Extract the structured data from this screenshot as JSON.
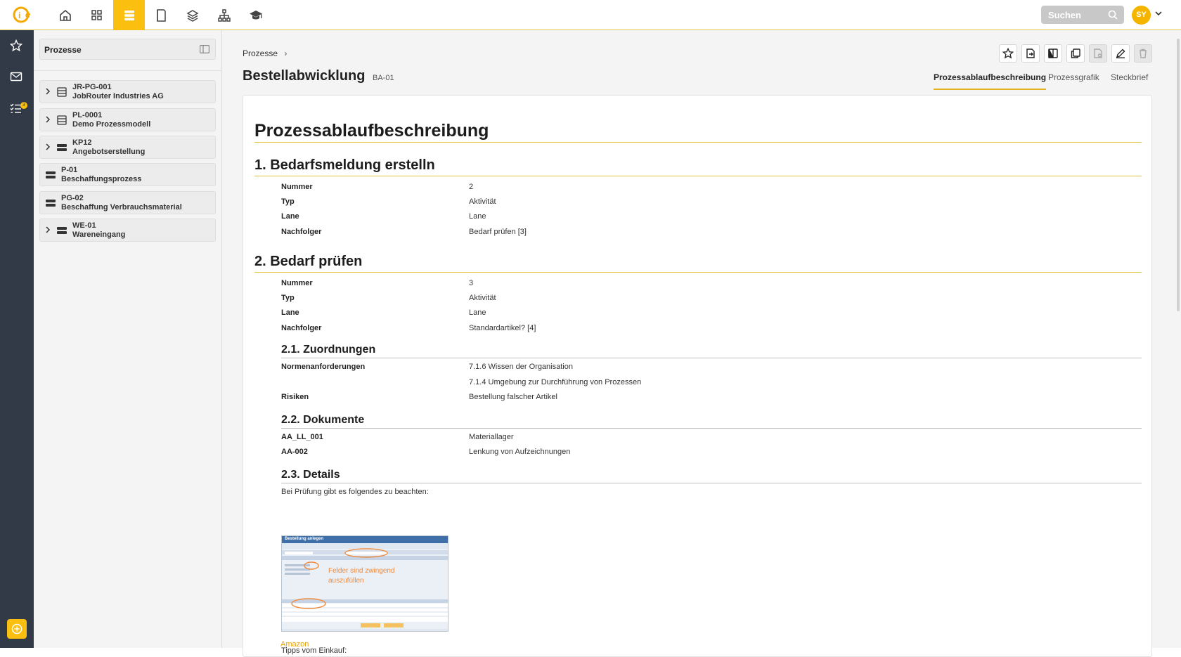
{
  "topbar": {
    "search_label": "Suchen",
    "avatar_initials": "SY",
    "nav_icons": [
      "home-icon",
      "dashboard-icon",
      "processes-icon",
      "documents-icon",
      "layers-icon",
      "org-chart-icon",
      "academy-icon"
    ],
    "active_nav": "processes-icon",
    "accent_color": "#fbbf0f"
  },
  "rail": {
    "icons": [
      "star-icon",
      "mail-icon",
      "task-list-icon"
    ],
    "task_badge": "3",
    "add_icon": "plus-circle-icon"
  },
  "sidebar": {
    "title": "Prozesse",
    "items": [
      {
        "code": "JR-PG-001",
        "name": "JobRouter Industries AG",
        "expandable": true,
        "icon": "process-group-icon"
      },
      {
        "code": "PL-0001",
        "name": "Demo Prozessmodell",
        "expandable": true,
        "icon": "process-group-icon"
      },
      {
        "code": "KP12",
        "name": "Angebotserstellung",
        "expandable": true,
        "icon": "process-icon"
      },
      {
        "code": "P-01",
        "name": "Beschaffungsprozess",
        "expandable": false,
        "icon": "process-icon"
      },
      {
        "code": "PG-02",
        "name": "Beschaffung Verbrauchsmaterial",
        "expandable": false,
        "icon": "process-icon"
      },
      {
        "code": "WE-01",
        "name": "Wareneingang",
        "expandable": true,
        "icon": "process-icon"
      }
    ]
  },
  "header": {
    "breadcrumb": "Prozesse",
    "title": "Bestellabwicklung",
    "code": "BA-01",
    "toolbar_icons": [
      "star-icon",
      "export-icon",
      "compare-icon",
      "copy-icon",
      "document-disabled-icon",
      "edit-icon",
      "delete-icon"
    ],
    "tabs": [
      "Prozessablaufbeschreibung",
      "Prozessgrafik",
      "Steckbrief"
    ],
    "active_tab": "Prozessablaufbeschreibung"
  },
  "content": {
    "title": "Prozessablaufbeschreibung",
    "s1": {
      "heading": "1. Bedarfsmeldung erstelln",
      "rows": [
        {
          "label": "Nummer",
          "value": "2"
        },
        {
          "label": "Typ",
          "value": "Aktivität"
        },
        {
          "label": "Lane",
          "value": "Lane"
        },
        {
          "label": "Nachfolger",
          "value": "Bedarf prüfen [3]"
        }
      ]
    },
    "s2": {
      "heading": "2. Bedarf prüfen",
      "rows": [
        {
          "label": "Nummer",
          "value": "3"
        },
        {
          "label": "Typ",
          "value": "Aktivität"
        },
        {
          "label": "Lane",
          "value": "Lane"
        },
        {
          "label": "Nachfolger",
          "value": "Standardartikel? [4]"
        }
      ],
      "zuordnungen": {
        "heading": "2.1. Zuordnungen",
        "norm_label": "Normenanforderungen",
        "norm_values": [
          "7.1.6 Wissen der Organisation",
          "7.1.4 Umgebung zur Durchführung von Prozessen"
        ],
        "risk_label": "Risiken",
        "risk_value": "Bestellung falscher Artikel"
      },
      "dokumente": {
        "heading": "2.2. Dokumente",
        "rows": [
          {
            "label": "AA_LL_001",
            "value": "Materiallager"
          },
          {
            "label": "AA-002",
            "value": "Lenkung von Aufzeichnungen"
          }
        ]
      },
      "details": {
        "heading": "2.3. Details",
        "intro": "Bei Prüfung gibt es folgendes zu beachten:",
        "screenshot_title": "Bestellung anlegen",
        "screenshot_note": "Felder sind zwingend auszufüllen",
        "tips": "Tipps vom Einkauf:",
        "link": "Amazon"
      }
    }
  }
}
